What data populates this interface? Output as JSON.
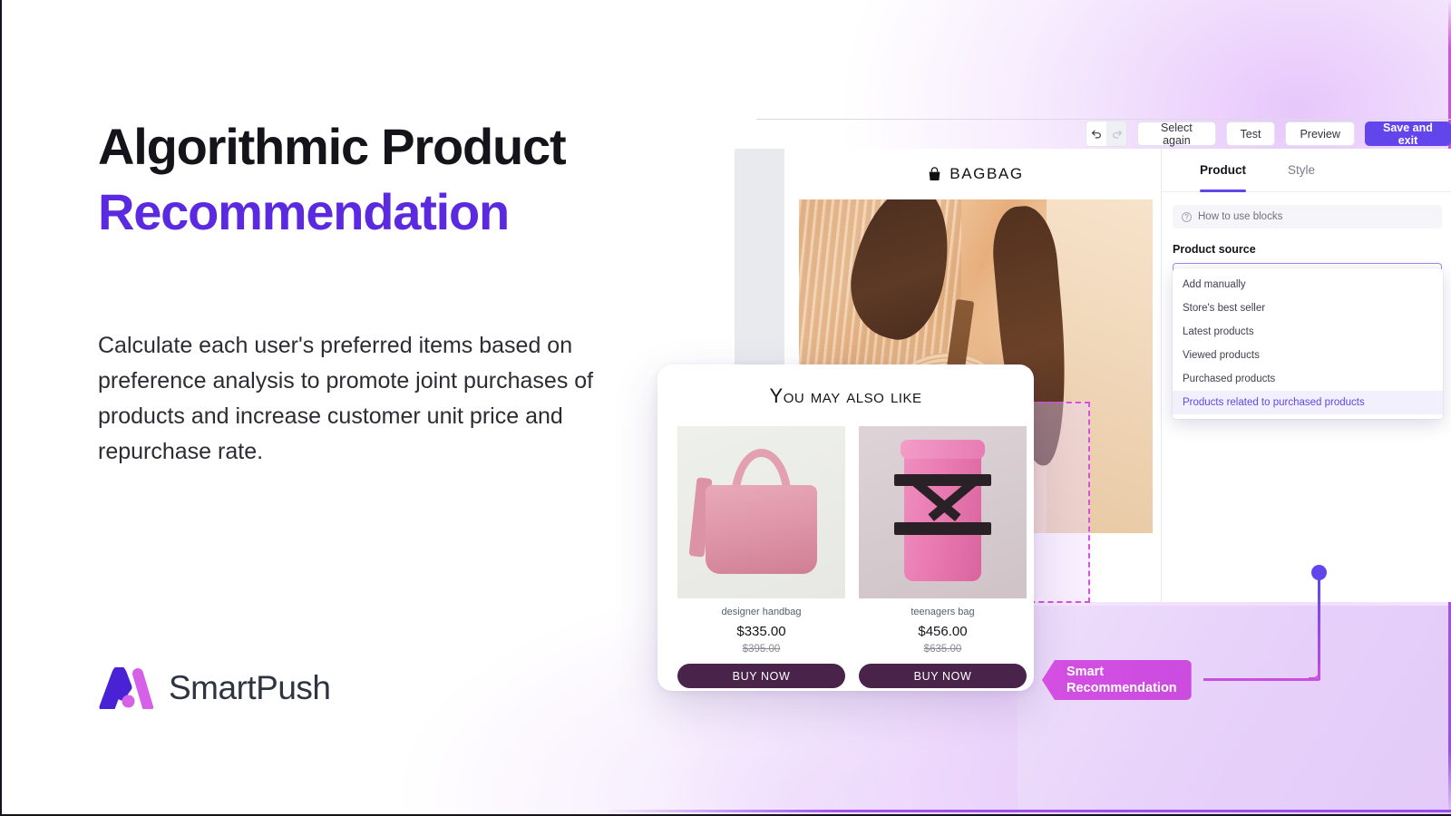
{
  "hero": {
    "headline_line1": "Algorithmic Product",
    "headline_line2": "Recommendation",
    "body": "Calculate each user's preferred items based on preference analysis to promote joint purchases of products and increase customer unit price and repurchase rate.",
    "accent_color": "#5b2ae0"
  },
  "logo": {
    "name": "SmartPush",
    "mark_left_color": "#4a22d6",
    "mark_right_color": "#d661e8"
  },
  "toolbar": {
    "undo_icon": "undo-arrow-icon",
    "redo_icon": "redo-arrow-icon",
    "select_again": "Select again",
    "test": "Test",
    "preview": "Preview",
    "save_and_exit": "Save and exit",
    "primary_color": "#6246eb"
  },
  "email_preview": {
    "brand_icon": "handbag-icon",
    "brand_name": "BAGBAG"
  },
  "panel": {
    "tabs": [
      {
        "label": "Product",
        "active": true
      },
      {
        "label": "Style",
        "active": false
      }
    ],
    "help": {
      "icon": "question-circle-icon",
      "label": "How to use blocks"
    },
    "product_source": {
      "label": "Product source",
      "placeholder": "Products related to purchased products",
      "caret_icon": "chevron-up-icon",
      "selected": "Products related to purchased products",
      "options": [
        "Add manually",
        "Store's best seller",
        "Latest products",
        "Viewed products",
        "Purchased products",
        "Products related to purchased products"
      ]
    }
  },
  "recommendation_card": {
    "title": "You may also like",
    "items": [
      {
        "image": "pink-designer-handbag-photo",
        "name": "designer handbag",
        "price": "$335.00",
        "old_price": "$395.00",
        "cta": "BUY NOW"
      },
      {
        "image": "pink-teenagers-bag-photo",
        "name": "teenagers bag",
        "price": "$456.00",
        "old_price": "$635.00",
        "cta": "BUY NOW"
      }
    ],
    "cta_color": "#49234a"
  },
  "badge": {
    "line1": "Smart",
    "line2": "Recommendation",
    "color": "#cb4ce0"
  }
}
